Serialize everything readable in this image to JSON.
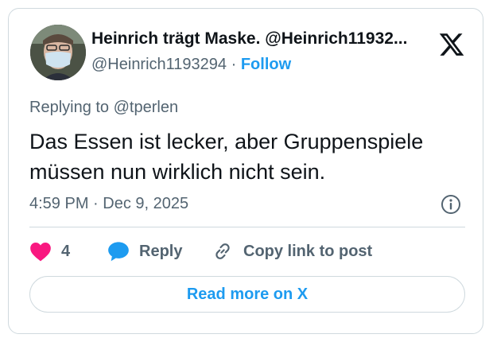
{
  "author": {
    "display_name": "Heinrich trägt Maske. @Heinrich11932...",
    "handle": "@Heinrich1193294",
    "separator": "·",
    "follow_label": "Follow"
  },
  "icons": {
    "logo": "x-logo-icon",
    "avatar": "profile-photo-masked-person",
    "info": "info-circle-icon",
    "like": "heart-icon",
    "reply": "speech-bubble-icon",
    "copy_link": "link-icon"
  },
  "tweet": {
    "replying_to": "Replying to @tperlen",
    "text": "Das Essen ist lecker, aber Gruppenspiele müssen nun wirklich nicht sein.",
    "time": "4:59 PM",
    "date_separator": "·",
    "date": "Dec 9, 2025"
  },
  "actions": {
    "like_count": "4",
    "reply_label": "Reply",
    "copy_link_label": "Copy link to post"
  },
  "footer": {
    "read_more_label": "Read more on X"
  },
  "colors": {
    "accent": "#1d9bf0",
    "like": "#f91880",
    "muted": "#536471",
    "text": "#0f1419",
    "border": "#cfd9de"
  }
}
